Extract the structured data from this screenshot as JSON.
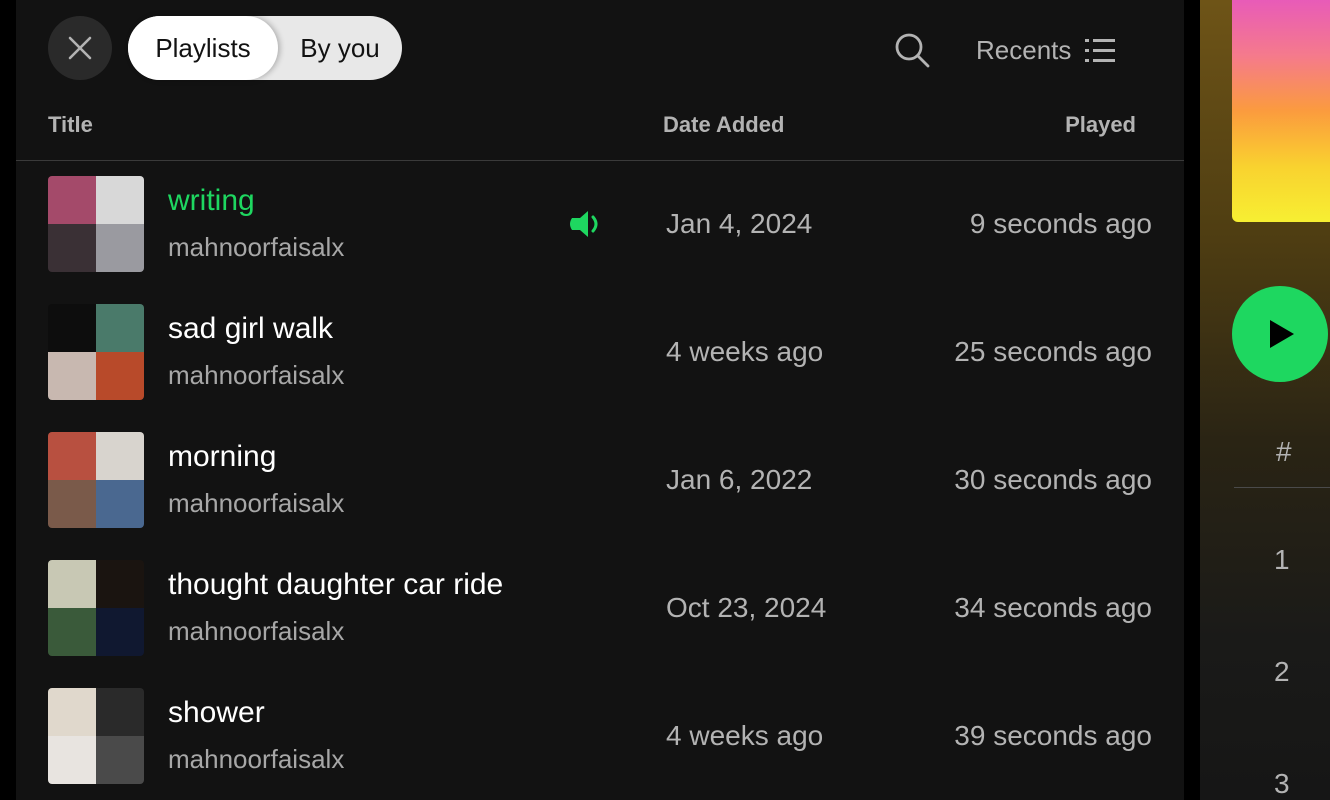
{
  "filters": {
    "close_icon": "close-icon",
    "chips": [
      "Playlists",
      "By you"
    ],
    "active_chip": "Playlists"
  },
  "toolbar": {
    "search_icon": "search-icon",
    "sort_label": "Recents",
    "sort_icon": "list-icon"
  },
  "columns": {
    "title": "Title",
    "date_added": "Date Added",
    "played": "Played"
  },
  "rows": [
    {
      "name": "writing",
      "owner": "mahnoorfaisalx",
      "date_added": "Jan 4, 2024",
      "played": "9 seconds ago",
      "is_playing": true,
      "cover_colors": [
        "#a44a6a",
        "#d8d8d8",
        "#3a3035",
        "#9a9aa0"
      ]
    },
    {
      "name": "sad girl walk",
      "owner": "mahnoorfaisalx",
      "date_added": "4 weeks ago",
      "played": "25 seconds ago",
      "is_playing": false,
      "cover_colors": [
        "#0d0d0d",
        "#4a7a6a",
        "#c8b8b0",
        "#b84a2a"
      ]
    },
    {
      "name": "morning",
      "owner": "mahnoorfaisalx",
      "date_added": "Jan 6, 2022",
      "played": "30 seconds ago",
      "is_playing": false,
      "cover_colors": [
        "#b85040",
        "#d8d4ce",
        "#7a5a4a",
        "#4a6890"
      ]
    },
    {
      "name": "thought daughter car ride",
      "owner": "mahnoorfaisalx",
      "date_added": "Oct 23, 2024",
      "played": "34 seconds ago",
      "is_playing": false,
      "cover_colors": [
        "#c8c8b4",
        "#1a1410",
        "#3a5a3a",
        "#101830"
      ]
    },
    {
      "name": "shower",
      "owner": "mahnoorfaisalx",
      "date_added": "4 weeks ago",
      "played": "39 seconds ago",
      "is_playing": false,
      "cover_colors": [
        "#e0d8cc",
        "#2a2a2a",
        "#e8e4e0",
        "#4a4a4a"
      ]
    }
  ],
  "now_playing_panel": {
    "play_icon": "play-icon",
    "column_hash": "#",
    "track_numbers": [
      "1",
      "2",
      "3"
    ],
    "accent_color": "#1ed760"
  }
}
